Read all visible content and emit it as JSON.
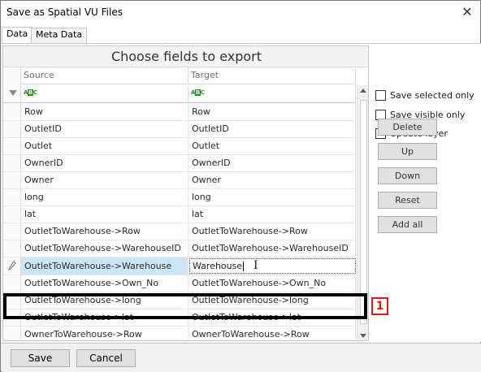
{
  "window": {
    "title": "Save as Spatial VU Files",
    "close_glyph": "✕"
  },
  "tabs": [
    {
      "label": "Data",
      "active": true
    },
    {
      "label": "Meta Data",
      "active": false
    }
  ],
  "grid": {
    "title": "Choose fields to export",
    "columns": {
      "source": "Source",
      "target": "Target"
    },
    "filter_icon": "filter-icon",
    "filter_cell_icon": "abc-text-filter-icon",
    "rows": [
      {
        "source": "Row",
        "target": "Row"
      },
      {
        "source": "OutletID",
        "target": "OutletID"
      },
      {
        "source": "Outlet",
        "target": "Outlet"
      },
      {
        "source": "OwnerID",
        "target": "OwnerID"
      },
      {
        "source": "Owner",
        "target": "Owner"
      },
      {
        "source": "long",
        "target": "long"
      },
      {
        "source": "lat",
        "target": "lat"
      },
      {
        "source": "OutletToWarehouse->Row",
        "target": "OutletToWarehouse->Row"
      },
      {
        "source": "OutletToWarehouse->WarehouseID",
        "target": "OutletToWarehouse->WarehouseID"
      },
      {
        "source": "OutletToWarehouse->Warehouse",
        "target": "Warehouse",
        "editing": true
      },
      {
        "source": "OutletToWarehouse->Own_No",
        "target": "OutletToWarehouse->Own_No"
      },
      {
        "source": "OutletToWarehouse->long",
        "target": "OutletToWarehouse->long"
      },
      {
        "source": "OutletToWarehouse->lat",
        "target": "OutletToWarehouse->lat"
      },
      {
        "source": "OwnerToWarehouse->Row",
        "target": "OwnerToWarehouse->Row"
      }
    ]
  },
  "options": {
    "save_selected_only": {
      "label": "Save selected only",
      "checked": false
    },
    "save_visible_only": {
      "label": "Save visible only",
      "checked": false
    },
    "update_layer": {
      "label": "Update layer",
      "checked": false
    }
  },
  "side_buttons": {
    "delete": "Delete",
    "up": "Up",
    "down": "Down",
    "reset": "Reset",
    "add_all": "Add all"
  },
  "footer": {
    "save": "Save",
    "cancel": "Cancel"
  },
  "annotation": {
    "marker": "1",
    "color": "#d91b1b"
  },
  "colors": {
    "selected_cell": "#cde6f7",
    "button_bg": "#e1e1e1"
  }
}
